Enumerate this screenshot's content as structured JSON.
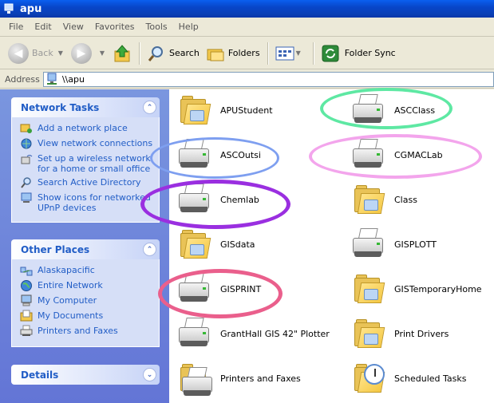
{
  "window": {
    "title": "apu"
  },
  "menu": [
    "File",
    "Edit",
    "View",
    "Favorites",
    "Tools",
    "Help"
  ],
  "toolbar": {
    "back_label": "Back",
    "search_label": "Search",
    "folders_label": "Folders",
    "foldersync_label": "Folder Sync"
  },
  "address": {
    "label": "Address",
    "value": "\\\\apu"
  },
  "network_tasks": {
    "title": "Network Tasks",
    "items": [
      "Add a network place",
      "View network connections",
      "Set up a wireless network for a home or small office",
      "Search Active Directory",
      "Show icons for networked UPnP devices"
    ]
  },
  "other_places": {
    "title": "Other Places",
    "items": [
      "Alaskapacific",
      "Entire Network",
      "My Computer",
      "My Documents",
      "Printers and Faxes"
    ]
  },
  "details": {
    "title": "Details"
  },
  "items": [
    {
      "label": "APUStudent",
      "icon": "shared-folder-icon"
    },
    {
      "label": "ASCClass",
      "icon": "printer-icon"
    },
    {
      "label": "ASCOutsi",
      "icon": "printer-icon"
    },
    {
      "label": "CGMACLab",
      "icon": "printer-icon"
    },
    {
      "label": "Chemlab",
      "icon": "printer-icon"
    },
    {
      "label": "Class",
      "icon": "shared-folder-icon"
    },
    {
      "label": "GISdata",
      "icon": "shared-folder-icon"
    },
    {
      "label": "GISPLOTT",
      "icon": "printer-icon"
    },
    {
      "label": "GISPRINT",
      "icon": "printer-icon"
    },
    {
      "label": "GISTemporaryHome",
      "icon": "shared-folder-icon"
    },
    {
      "label": "GrantHall GIS 42\" Plotter",
      "icon": "printer-icon"
    },
    {
      "label": "Print Drivers",
      "icon": "shared-folder-icon"
    },
    {
      "label": "Printers and Faxes",
      "icon": "printers-faxes-folder-icon"
    },
    {
      "label": "Scheduled Tasks",
      "icon": "scheduled-tasks-icon"
    }
  ],
  "colors": {
    "highlight_green": "#5ee8a3",
    "highlight_blue": "#7e9ff0",
    "highlight_pink": "#f3a5ec",
    "highlight_purple": "#9a2fe0",
    "highlight_red": "#ea5f8c"
  }
}
